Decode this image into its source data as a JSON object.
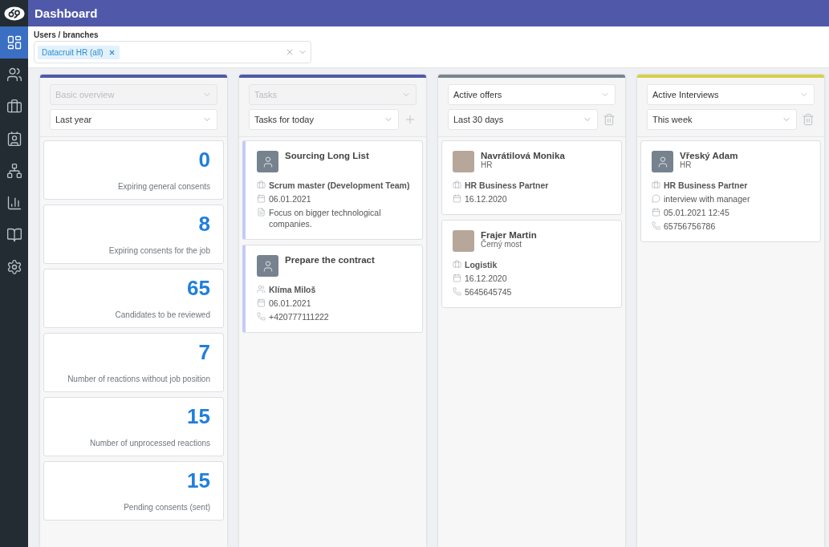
{
  "header": {
    "title": "Dashboard"
  },
  "sidebar": {
    "items": [
      {
        "kind": "dashboard",
        "selected": true
      },
      {
        "kind": "people",
        "selected": false
      },
      {
        "kind": "briefcase",
        "selected": false
      },
      {
        "kind": "contact",
        "selected": false
      },
      {
        "kind": "hierarchy",
        "selected": false
      },
      {
        "kind": "chart",
        "selected": false
      },
      {
        "kind": "book",
        "selected": false
      },
      {
        "kind": "settings",
        "selected": false
      }
    ]
  },
  "filter": {
    "label": "Users / branches",
    "tags": [
      "Datacruit HR (all)"
    ]
  },
  "columns": [
    {
      "color": "#5059a9",
      "type_select": {
        "value": "Basic overview",
        "disabled": true
      },
      "period_select": {
        "value": "Last year"
      },
      "stats": [
        {
          "value": "0",
          "label": "Expiring general consents"
        },
        {
          "value": "8",
          "label": "Expiring consents for the job"
        },
        {
          "value": "65",
          "label": "Candidates to be reviewed"
        },
        {
          "value": "7",
          "label": "Number of reactions without job position"
        },
        {
          "value": "15",
          "label": "Number of unprocessed reactions"
        },
        {
          "value": "15",
          "label": "Pending consents (sent)"
        }
      ]
    },
    {
      "color": "#5059a9",
      "type_select": {
        "value": "Tasks",
        "disabled": true
      },
      "period_select": {
        "value": "Tasks for today"
      },
      "action": {
        "kind": "add"
      },
      "cards": [
        {
          "title": "Sourcing Long List",
          "avatar": {
            "kind": "placeholder"
          },
          "accent": true,
          "lines": [
            {
              "kind": "job",
              "text": "Scrum master (Development Team)",
              "bold": true
            },
            {
              "kind": "date",
              "text": "06.01.2021",
              "bold": false
            },
            {
              "kind": "note",
              "text": "Focus on bigger technological companies.",
              "bold": false
            }
          ]
        },
        {
          "title": "Prepare the contract",
          "avatar": {
            "kind": "placeholder"
          },
          "accent": true,
          "lines": [
            {
              "kind": "person",
              "text": "Klíma Miloš",
              "bold": true
            },
            {
              "kind": "date",
              "text": "06.01.2021",
              "bold": false
            },
            {
              "kind": "phone",
              "text": "+420777111222",
              "bold": false
            }
          ]
        }
      ]
    },
    {
      "color": "#78848e",
      "type_select": {
        "value": "Active offers",
        "disabled": false
      },
      "period_select": {
        "value": "Last 30 days"
      },
      "action": {
        "kind": "delete"
      },
      "cards": [
        {
          "title": "Navrátilová Monika",
          "subtitle": "HR",
          "avatar": {
            "kind": "photo"
          },
          "accent": false,
          "lines": [
            {
              "kind": "job",
              "text": "HR Business Partner",
              "bold": true
            },
            {
              "kind": "date",
              "text": "16.12.2020",
              "bold": false
            }
          ]
        },
        {
          "title": "Frajer Martin",
          "subtitle": "Černý most",
          "avatar": {
            "kind": "photo"
          },
          "accent": false,
          "lines": [
            {
              "kind": "job",
              "text": "Logistik",
              "bold": true
            },
            {
              "kind": "date",
              "text": "16.12.2020",
              "bold": false
            },
            {
              "kind": "phone",
              "text": "5645645745",
              "bold": false
            }
          ]
        }
      ]
    },
    {
      "color": "#d6d04a",
      "type_select": {
        "value": "Active Interviews",
        "disabled": false
      },
      "period_select": {
        "value": "This week"
      },
      "action": {
        "kind": "delete"
      },
      "cards": [
        {
          "title": "Vřeský Adam",
          "subtitle": "HR",
          "avatar": {
            "kind": "placeholder"
          },
          "accent": false,
          "lines": [
            {
              "kind": "job",
              "text": "HR Business Partner",
              "bold": true
            },
            {
              "kind": "chat",
              "text": "interview with manager",
              "bold": false
            },
            {
              "kind": "date",
              "text": "05.01.2021 12:45",
              "bold": false
            },
            {
              "kind": "phone",
              "text": "65756756786",
              "bold": false
            }
          ]
        }
      ]
    }
  ]
}
